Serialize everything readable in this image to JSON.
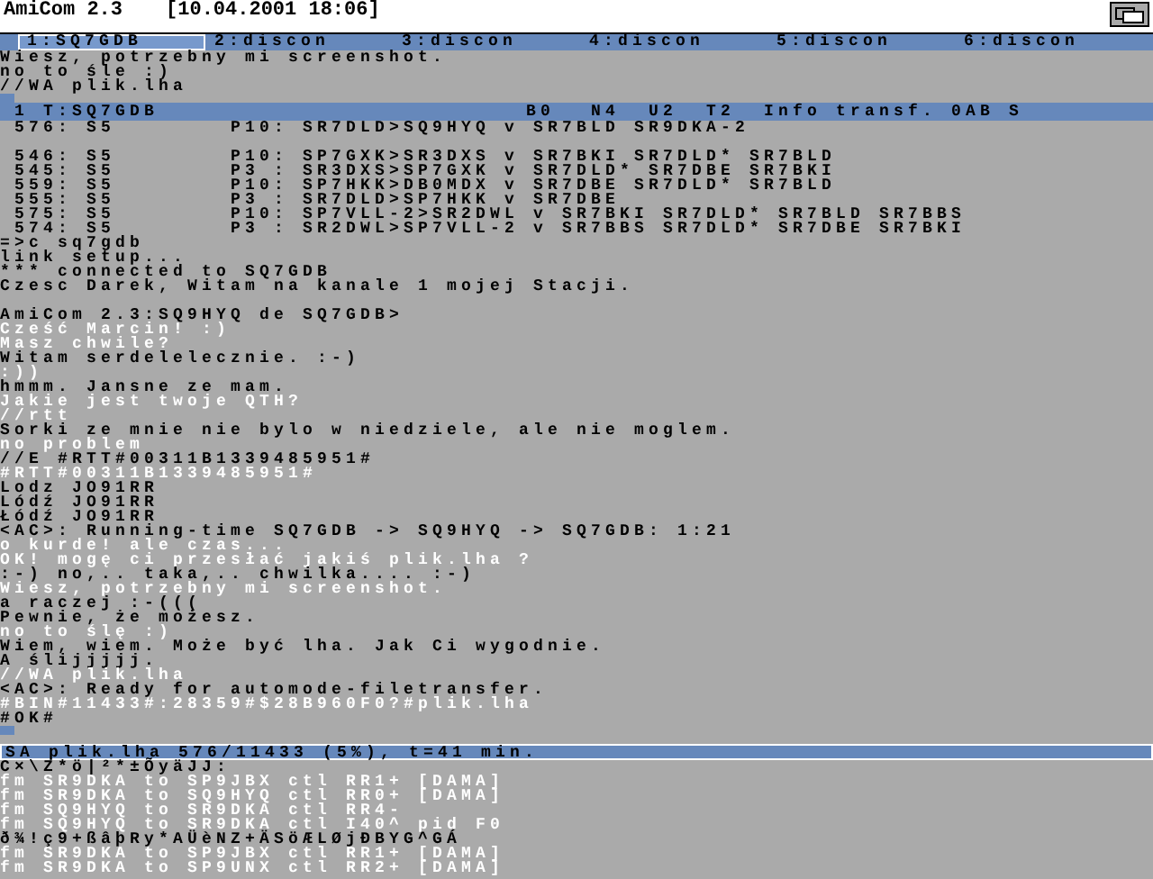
{
  "window": {
    "title": "AmiCom 2.3",
    "datetime": "[10.04.2001 18:06]"
  },
  "tabs": [
    {
      "label": "1:SQ7GDB",
      "selected": true
    },
    {
      "label": "2:discon",
      "selected": false
    },
    {
      "label": "3:discon",
      "selected": false
    },
    {
      "label": "4:discon",
      "selected": false
    },
    {
      "label": "5:discon",
      "selected": false
    },
    {
      "label": "6:discon",
      "selected": false
    }
  ],
  "top_pane": {
    "lines": [
      {
        "text": "Wiesz, potrzebny mi screenshot.",
        "color": "#000000"
      },
      {
        "text": "no to śle :)",
        "color": "#000000"
      },
      {
        "text": "//WA plik.lha",
        "color": "#000000"
      }
    ]
  },
  "status_bar": {
    "channel": "1 T:SQ7GDB",
    "fields": [
      "B0",
      "N4",
      "U2",
      "T2",
      "Info transf.",
      "0AB S"
    ]
  },
  "monitor": {
    "blocks": [
      [
        " 576: S5        P10: SR7DLD>SQ9HYQ v SR7BLD SR9DKA-2"
      ],
      [
        " 546: S5        P10: SP7GXK>SR3DXS v SR7BKI SR7DLD* SR7BLD",
        " 545: S5        P3 : SR3DXS>SP7GXK v SR7DLD* SR7DBE SR7BKI",
        " 559: S5        P10: SP7HKK>DB0MDX v SR7DBE SR7DLD* SR7BLD",
        " 555: S5        P3 : SR7DLD>SP7HKK v SR7DBE",
        " 575: S5        P10: SP7VLL-2>SR2DWL v SR7BKI SR7DLD* SR7BLD SR7BBS",
        " 574: S5        P3 : SR2DWL>SP7VLL-2 v SR7BBS SR7DLD* SR7DBE SR7BKI"
      ]
    ]
  },
  "terminal": {
    "blocks": [
      [
        {
          "text": "=>c sq7gdb",
          "color": "#000000"
        },
        {
          "text": "link setup...",
          "color": "#000000"
        },
        {
          "text": "*** connected to SQ7GDB",
          "color": "#000000"
        },
        {
          "text": "Czesc Darek, Witam na kanale 1 mojej Stacji.",
          "color": "#000000"
        }
      ],
      [
        {
          "text": "AmiCom 2.3:SQ9HYQ de SQ7GDB>",
          "color": "#000000"
        },
        {
          "text": "Cześć Marcin! :)",
          "color": "#ffffff"
        },
        {
          "text": "Masz chwile?",
          "color": "#ffffff"
        },
        {
          "text": "Witam serdelelecznie. :-)",
          "color": "#000000"
        },
        {
          "text": ":))",
          "color": "#ffffff"
        },
        {
          "text": "hmmm. Jansne ze mam.",
          "color": "#000000"
        },
        {
          "text": "Jakie jest twoje QTH?",
          "color": "#ffffff"
        },
        {
          "text": "//rtt",
          "color": "#ffffff"
        },
        {
          "text": "Sorki ze mnie nie bylo w niedziele, ale nie moglem.",
          "color": "#000000"
        },
        {
          "text": "no problem",
          "color": "#ffffff"
        },
        {
          "text": "//E #RTT#00311B1339485951#",
          "color": "#000000"
        },
        {
          "text": "#RTT#00311B1339485951#",
          "color": "#ffffff"
        },
        {
          "text": "Lodz JO91RR",
          "color": "#000000"
        },
        {
          "text": "Lódź JO91RR",
          "color": "#000000"
        },
        {
          "text": "Łódź JO91RR",
          "color": "#000000"
        },
        {
          "text": "<AC>: Running-time SQ7GDB -> SQ9HYQ -> SQ7GDB: 1:21",
          "color": "#000000"
        },
        {
          "text": "o kurde! ale czas...",
          "color": "#ffffff"
        },
        {
          "text": "OK! mogę ci przesłać jakiś plik.lha ?",
          "color": "#ffffff"
        },
        {
          "text": ":-) no,.. taka,.. chwilka.... :-)",
          "color": "#000000"
        },
        {
          "text": "Wiesz, potrzebny mi screenshot.",
          "color": "#ffffff"
        },
        {
          "text": "a raczej :-(((",
          "color": "#000000"
        },
        {
          "text": "Pewnie, że możesz.",
          "color": "#000000"
        },
        {
          "text": "no to ślę :)",
          "color": "#ffffff"
        },
        {
          "text": "Wiem, wiem. Może być lha. Jak Ci wygodnie.",
          "color": "#000000"
        },
        {
          "text": "A ślijjjjj.",
          "color": "#000000"
        },
        {
          "text": "//WA plik.lha",
          "color": "#ffffff"
        },
        {
          "text": "<AC>: Ready for automode-filetransfer.",
          "color": "#000000"
        },
        {
          "text": "#BIN#11433#:28359#$28B960F0?#plik.lha",
          "color": "#ffffff"
        },
        {
          "text": "#OK#",
          "color": "#000000"
        }
      ]
    ]
  },
  "transfer_bar": {
    "text": "SA plik.lha 576/11433 (5%), t=41 min."
  },
  "bottom_pane": {
    "lines": [
      {
        "text": "C×\\Z*ö|²*±ÕyäJJ:",
        "color": "#000000"
      },
      {
        "text": "fm SR9DKA to SP9JBX ctl RR1+ [DAMA]",
        "color": "#ffffff"
      },
      {
        "text": "fm SR9DKA to SQ9HYQ ctl RR0+ [DAMA]",
        "color": "#ffffff"
      },
      {
        "text": "fm SQ9HYQ to SR9DKA ctl RR4-",
        "color": "#ffffff"
      },
      {
        "text": "fm SQ9HYQ to SR9DKA ctl I40^ pid F0",
        "color": "#ffffff"
      },
      {
        "text": "ð¾!ç9+ßâþRy*AÜèNZ+ÄSöÆLØjÐBYG^GÁ",
        "color": "#000000"
      },
      {
        "text": "fm SR9DKA to SP9JBX ctl RR1+ [DAMA]",
        "color": "#ffffff"
      },
      {
        "text": "fm SR9DKA to SP9UNX ctl RR2+ [DAMA]",
        "color": "#ffffff"
      }
    ]
  }
}
